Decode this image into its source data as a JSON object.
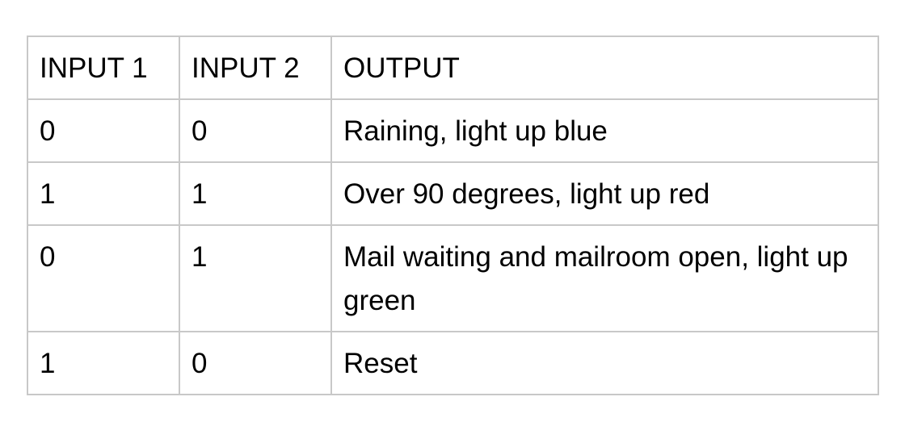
{
  "table": {
    "headers": [
      "INPUT 1",
      "INPUT 2",
      "OUTPUT"
    ],
    "rows": [
      [
        "0",
        "0",
        "Raining, light up blue"
      ],
      [
        "1",
        "1",
        "Over 90 degrees, light up red"
      ],
      [
        "0",
        "1",
        "Mail waiting and mailroom open, light up green"
      ],
      [
        "1",
        "0",
        "Reset"
      ]
    ]
  }
}
